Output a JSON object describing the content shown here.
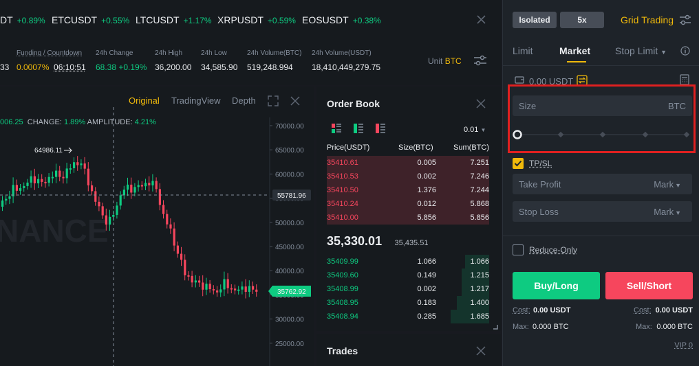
{
  "ticker": [
    {
      "sym": "DT",
      "pct": "+0.89%"
    },
    {
      "sym": "ETCUSDT",
      "pct": "+0.55%"
    },
    {
      "sym": "LTCUSDT",
      "pct": "+1.17%"
    },
    {
      "sym": "XRPUSDT",
      "pct": "+0.59%"
    },
    {
      "sym": "EOSUSDT",
      "pct": "+0.38%"
    }
  ],
  "stats": {
    "partial_value": "33",
    "funding_label": "Funding / Countdown",
    "funding_rate": "0.0007%",
    "countdown": "06:10:51",
    "change_label": "24h Change",
    "change_value": "68.38 +0.19%",
    "high_label": "24h High",
    "high_value": "36,200.00",
    "low_label": "24h Low",
    "low_value": "34,585.90",
    "vol_btc_label": "24h Volume(BTC)",
    "vol_btc_value": "519,248.994",
    "vol_usdt_label": "24h Volume(USDT)",
    "vol_usdt_value": "18,410,449,279.75",
    "unit_label": "Unit",
    "unit_value": "BTC"
  },
  "chart": {
    "tab_original": "Original",
    "tab_tradingview": "TradingView",
    "tab_depth": "Depth",
    "info_open": "006.25",
    "info_change_label": "CHANGE:",
    "info_change": "1.89%",
    "info_amp_label": "AMPLITUDE:",
    "info_amp": "4.21%",
    "watermark": "NANCE",
    "peak_label": "64986.11",
    "crosshair_price": "55781.96",
    "last_price": "35762.92",
    "axis": [
      "70000.00",
      "65000.00",
      "60000.00",
      "55000.00",
      "50000.00",
      "45000.00",
      "40000.00",
      "35000.00",
      "30000.00",
      "25000.00"
    ]
  },
  "orderbook": {
    "title": "Order Book",
    "precision": "0.01",
    "col_price": "Price(USDT)",
    "col_size": "Size(BTC)",
    "col_sum": "Sum(BTC)",
    "asks": [
      {
        "price": "35410.61",
        "size": "0.005",
        "sum": "7.251"
      },
      {
        "price": "35410.53",
        "size": "0.002",
        "sum": "7.246"
      },
      {
        "price": "35410.50",
        "size": "1.376",
        "sum": "7.244"
      },
      {
        "price": "35410.24",
        "size": "0.012",
        "sum": "5.868"
      },
      {
        "price": "35410.00",
        "size": "5.856",
        "sum": "5.856"
      }
    ],
    "last_price": "35,330.01",
    "mark_price": "35,435.51",
    "bids": [
      {
        "price": "35409.99",
        "size": "1.066",
        "sum": "1.066"
      },
      {
        "price": "35409.60",
        "size": "0.149",
        "sum": "1.215"
      },
      {
        "price": "35408.99",
        "size": "0.002",
        "sum": "1.217"
      },
      {
        "price": "35408.95",
        "size": "0.183",
        "sum": "1.400"
      },
      {
        "price": "35408.94",
        "size": "0.285",
        "sum": "1.685"
      }
    ]
  },
  "trades": {
    "title": "Trades"
  },
  "order": {
    "margin_mode": "Isolated",
    "leverage": "5x",
    "grid_trading": "Grid Trading",
    "tab_limit": "Limit",
    "tab_market": "Market",
    "tab_stop_limit": "Stop Limit",
    "balance": "0.00 USDT",
    "size_placeholder": "Size",
    "size_unit": "BTC",
    "tpsl_label": "TP/SL",
    "take_profit": "Take Profit",
    "stop_loss": "Stop Loss",
    "mark_label": "Mark",
    "reduce_only": "Reduce-Only",
    "buy_label": "Buy/Long",
    "sell_label": "Sell/Short",
    "cost_label": "Cost:",
    "cost_buy": "0.00 USDT",
    "cost_sell": "0.00 USDT",
    "max_label": "Max:",
    "max_buy": "0.000 BTC",
    "max_sell": "0.000 BTC",
    "vip": "VIP 0"
  },
  "colors": {
    "accent": "#f0b90b",
    "up": "#0ecb81",
    "down": "#f6465d",
    "highlight": "#e02020"
  }
}
